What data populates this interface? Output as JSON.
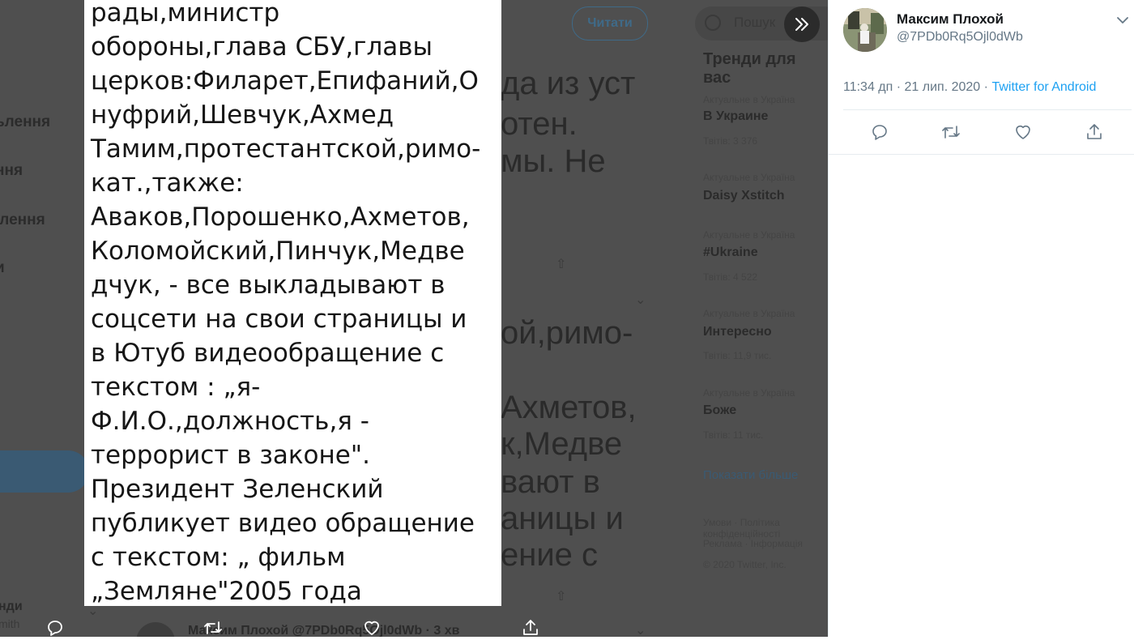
{
  "background": {
    "nav_items": [
      "ьлення",
      "ння",
      "ілення",
      "и",
      "›"
    ],
    "follow_label": "Читати",
    "search_placeholder": "Пошук",
    "trends_title": "Тренди для вас",
    "trends": [
      {
        "meta": "Актуальне в Україна",
        "name": "В Украине",
        "count": "Твітів: 3 376"
      },
      {
        "meta": "Актуальне в Україна",
        "name": "Daisy Xstitch",
        "count": ""
      },
      {
        "meta": "Актуальне в Україна",
        "name": "#Ukraine",
        "count": "Твітів: 4 522"
      },
      {
        "meta": "Актуальне в Україна",
        "name": "Интересно",
        "count": "Твітів: 11,9 тис."
      },
      {
        "meta": "Актуальне в Україна",
        "name": "Боже",
        "count": "Твітів: 11 тис."
      }
    ],
    "show_more": "Показати більше",
    "footer_lines": [
      "Умови · Політика конфіденційності",
      "Реклама · Інформація",
      "© 2020 Twitter, Inc."
    ],
    "tweet_text_lines": [
      "да из уст",
      "отен.",
      "мы. Не",
      "ой,римо-",
      "Ахметов,",
      "к,Медве",
      "вают в",
      "аницы и",
      "ение с"
    ],
    "bottom_author": "Максим Плохой @7PDb0Rq5Ojl0dWb · 3 хв",
    "left_bottom_name": "нди",
    "left_bottom_handle": "mith"
  },
  "media": {
    "text_lines": [
      "рады,министр",
      "обороны,глава СБУ,главы",
      "церков:Филарет,Епифаний,О",
      "нуфрий,Шевчук,Ахмед",
      "Тамим,протестантской,римо-",
      "кат.,также:",
      "Аваков,Порошенко,Ахметов,",
      "Коломойский,Пинчук,Медве",
      "дчук, - все выкладывают в",
      "соцсети на свои страницы и",
      "в Ютуб видеообращение с",
      "текстом : „я-",
      "Ф.И.О.,должность,я -",
      "террорист в законе\".",
      "Президент Зеленский",
      "публикует видео обращение",
      "с текстом: „ фильм",
      "„Земляне\"2005 года"
    ],
    "icons": [
      "reply-icon",
      "retweet-icon",
      "like-icon",
      "share-icon",
      "collapse-icon"
    ]
  },
  "tweet": {
    "author_name": "Максим Плохой",
    "author_handle": "@7PDb0Rq5Ojl0dWb",
    "time": "11:34 дп",
    "date": "21 лип. 2020",
    "separator": "·",
    "source": "Twitter for Android",
    "actions": [
      "reply-icon",
      "retweet-icon",
      "like-icon",
      "share-icon"
    ]
  },
  "colors": {
    "accent": "#1da1f2",
    "secondary_text": "#657786",
    "primary_text": "#14171a",
    "overlay": "#4f4f4f"
  }
}
